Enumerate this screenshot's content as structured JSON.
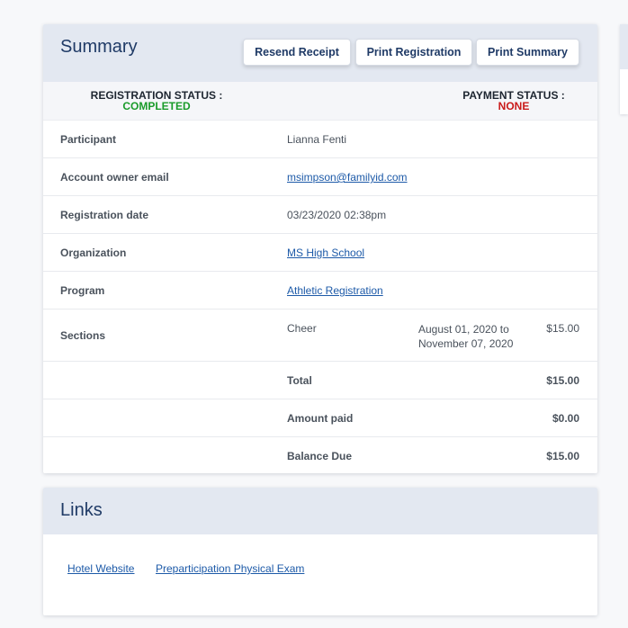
{
  "summary": {
    "title": "Summary",
    "buttons": {
      "resend_receipt": "Resend Receipt",
      "print_registration": "Print Registration",
      "print_summary": "Print Summary"
    },
    "registration_status": {
      "label": "REGISTRATION STATUS :",
      "value": "COMPLETED"
    },
    "payment_status": {
      "label": "PAYMENT STATUS :",
      "value": "NONE"
    },
    "rows": {
      "participant": {
        "label": "Participant",
        "value": "Lianna Fenti"
      },
      "account_email": {
        "label": "Account owner email",
        "value": "msimpson@familyid.com"
      },
      "registration_date": {
        "label": "Registration date",
        "value": "03/23/2020 02:38pm"
      },
      "organization": {
        "label": "Organization",
        "value": "MS High School"
      },
      "program": {
        "label": "Program",
        "value": "Athletic Registration"
      },
      "sections": {
        "label": "Sections",
        "name": "Cheer",
        "dates_line1": "August 01, 2020 to",
        "dates_line2": "November 07, 2020",
        "price": "$15.00"
      }
    },
    "totals": {
      "total": {
        "label": "Total",
        "value": "$15.00"
      },
      "amount_paid": {
        "label": "Amount paid",
        "value": "$0.00"
      },
      "balance_due": {
        "label": "Balance Due",
        "value": "$15.00"
      }
    }
  },
  "links": {
    "title": "Links",
    "items": [
      "Hotel Website",
      "Preparticipation Physical Exam"
    ]
  },
  "colors": {
    "header_bg": "#e3e8f1",
    "title": "#1f3a66",
    "status_completed": "#1a9b2a",
    "status_none": "#c91a1a",
    "link": "#1d5aa8"
  }
}
